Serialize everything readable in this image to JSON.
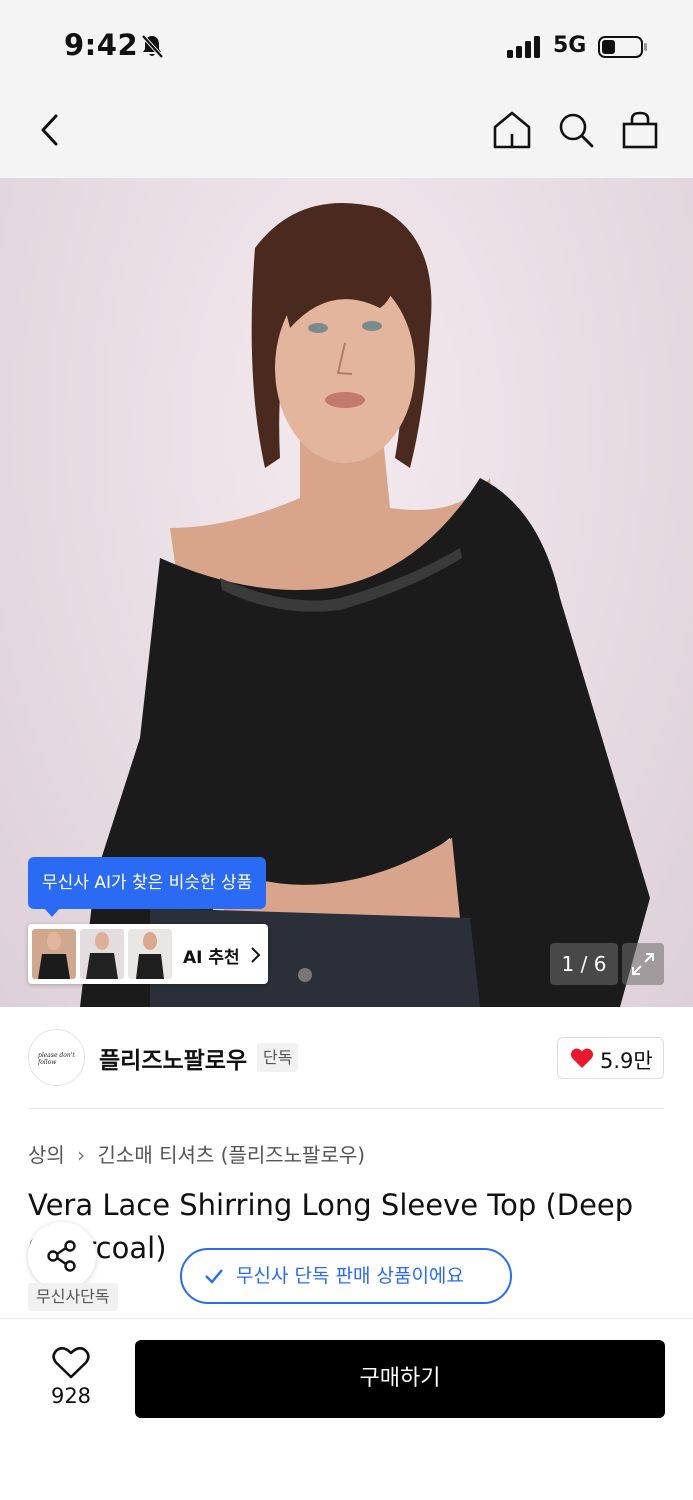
{
  "status_bar": {
    "time": "9:42",
    "network": "5G",
    "icons": [
      "bell-off-icon",
      "signal-icon",
      "battery-icon"
    ]
  },
  "nav": {
    "icons": [
      "back-icon",
      "home-icon",
      "search-icon",
      "shopping-bag-icon"
    ]
  },
  "gallery": {
    "counter": "1 / 6",
    "ai_tooltip": "무신사 AI가 찾은 비슷한 상품",
    "ai_reco_label": "AI 추천",
    "icons": [
      "chevron-right-icon",
      "expand-icon"
    ]
  },
  "brand": {
    "name": "플리즈노팔로우",
    "badge": "단독",
    "logo_text": "please don't follow",
    "likes": "5.9만"
  },
  "breadcrumb": {
    "category": "상의",
    "subcategory": "긴소매 티셔츠 (플리즈노팔로우)"
  },
  "product": {
    "title": "Vera Lace Shirring Long Sleeve Top (Deep Charcoal)",
    "exclusive_label": "무신사 단독 판매 상품이에요",
    "tag": "무신사단독"
  },
  "bottom_bar": {
    "wish_count": "928",
    "buy_label": "구매하기"
  },
  "colors": {
    "accent": "#2b6bf3",
    "heart": "#e8192c",
    "buy_button": "#000000"
  }
}
